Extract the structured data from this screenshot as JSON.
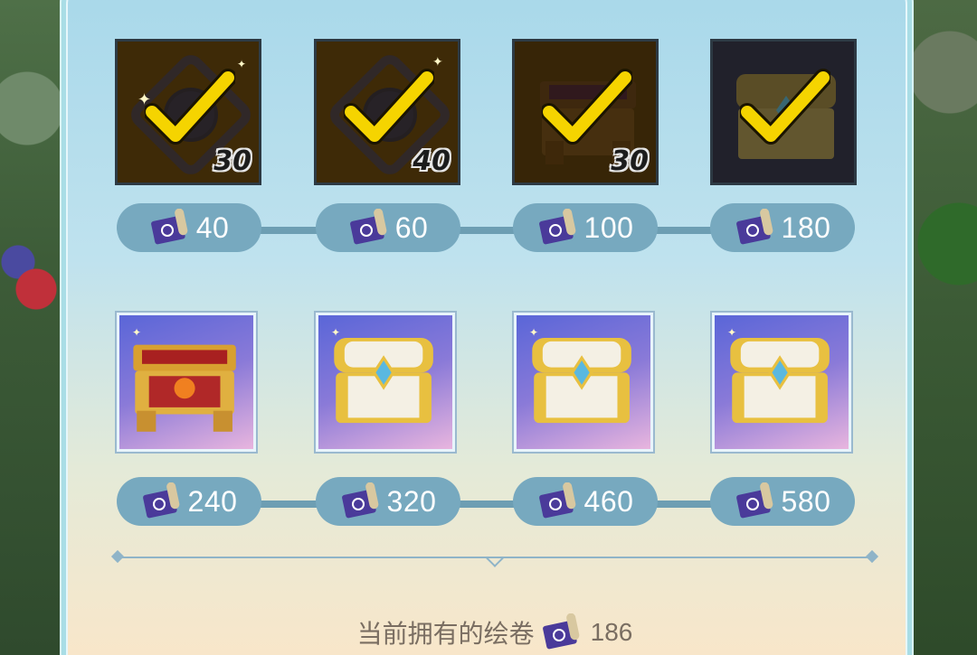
{
  "colors": {
    "check": "#f5d400",
    "scroll_purple": "#4a3a9a",
    "pill": "#77a9bf",
    "panel": "#a9dde6"
  },
  "rewards_row1": [
    {
      "kind": "crystal-knot",
      "count": "30",
      "cost": "40",
      "claimed": true
    },
    {
      "kind": "crystal-knot",
      "count": "40",
      "cost": "60",
      "claimed": true
    },
    {
      "kind": "dark-chest",
      "count": "30",
      "cost": "100",
      "claimed": true
    },
    {
      "kind": "gold-chest",
      "count": "",
      "cost": "180",
      "claimed": true
    }
  ],
  "rewards_row2": [
    {
      "kind": "red-gold-chest",
      "cost": "240",
      "claimed": false
    },
    {
      "kind": "white-gold-chest",
      "cost": "320",
      "claimed": false
    },
    {
      "kind": "white-gold-chest",
      "cost": "460",
      "claimed": false
    },
    {
      "kind": "white-gold-chest",
      "cost": "580",
      "claimed": false
    }
  ],
  "footer": {
    "label": "当前拥有的绘卷",
    "owned": "186",
    "icon": "scroll-icon"
  }
}
